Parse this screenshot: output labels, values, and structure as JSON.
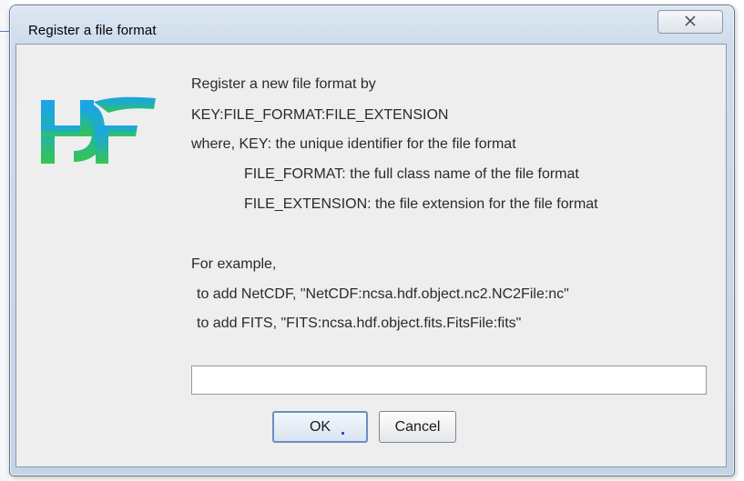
{
  "dialog": {
    "title": "Register a file format",
    "close_label": "☒"
  },
  "message": {
    "line1": "Register a new file format by",
    "line2": "KEY:FILE_FORMAT:FILE_EXTENSION",
    "line3": "where, KEY: the unique identifier for the file format",
    "line4": "FILE_FORMAT: the full class name of the file format",
    "line5": "FILE_EXTENSION: the file extension for the file format",
    "line6": "For example,",
    "line7": "to add NetCDF, \"NetCDF:ncsa.hdf.object.nc2.NC2File:nc\"",
    "line8": "to add FITS, \"FITS:ncsa.hdf.object.fits.FitsFile:fits\""
  },
  "input": {
    "value": ""
  },
  "buttons": {
    "ok_label": "OK",
    "cancel_label": "Cancel"
  },
  "icons": {
    "logo": "hdf-logo-icon",
    "close": "close-icon"
  },
  "colors": {
    "logo_top": "#1aa0e6",
    "logo_bottom": "#2fc25a",
    "window_frame": "#c9d6e8",
    "client_bg": "#eeeeee"
  }
}
